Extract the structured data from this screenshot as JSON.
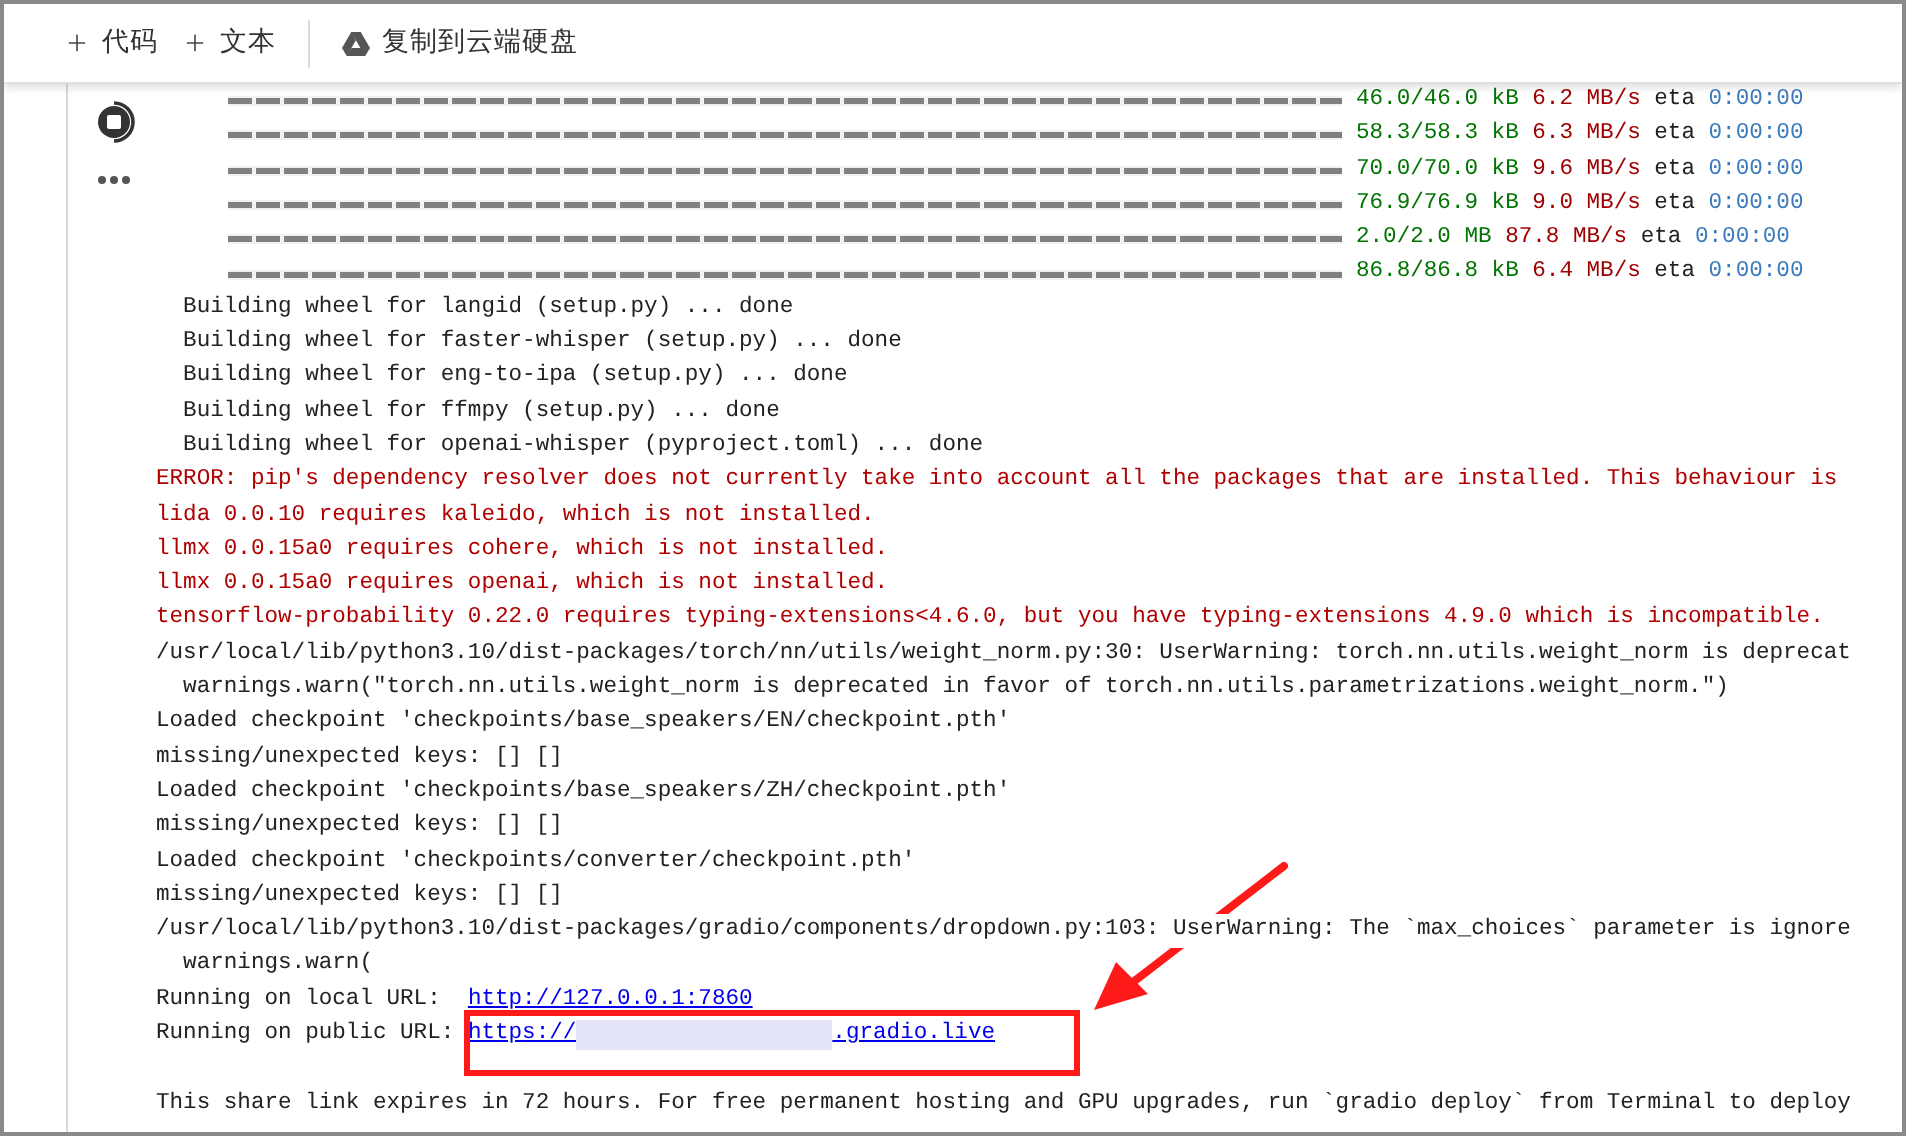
{
  "toolbar": {
    "buttons": [
      {
        "kind": "add",
        "label": "代码"
      },
      {
        "kind": "add",
        "label": "文本"
      },
      {
        "kind": "drive",
        "label": "复制到云端硬盘"
      }
    ]
  },
  "cell": {
    "running": true,
    "downloads": [
      {
        "level": 1,
        "size": "46.0/46.0 kB",
        "speed": "6.2 MB/s",
        "eta_label": "eta",
        "eta": "0:00:00"
      },
      {
        "level": 1,
        "size": "58.3/58.3 kB",
        "speed": "6.3 MB/s",
        "eta_label": "eta",
        "eta": "0:00:00"
      },
      {
        "level": 1,
        "size": "70.0/70.0 kB",
        "speed": "9.6 MB/s",
        "eta_label": "eta",
        "eta": "0:00:00"
      },
      {
        "level": 1,
        "size": "76.9/76.9 kB",
        "speed": "9.0 MB/s",
        "eta_label": "eta",
        "eta": "0:00:00"
      },
      {
        "level": 1,
        "size": "2.0/2.0 MB",
        "speed": "87.8 MB/s",
        "eta_label": "eta",
        "eta": "0:00:00"
      },
      {
        "level": 1,
        "size": "86.8/86.8 kB",
        "speed": "6.4 MB/s",
        "eta_label": "eta",
        "eta": "0:00:00"
      }
    ],
    "lines": [
      {
        "kind": "info",
        "text": "  Building wheel for langid (setup.py) ... done"
      },
      {
        "kind": "info",
        "text": "  Building wheel for faster-whisper (setup.py) ... done"
      },
      {
        "kind": "info",
        "text": "  Building wheel for eng-to-ipa (setup.py) ... done"
      },
      {
        "kind": "info",
        "text": "  Building wheel for ffmpy (setup.py) ... done"
      },
      {
        "kind": "info",
        "text": "  Building wheel for openai-whisper (pyproject.toml) ... done"
      },
      {
        "kind": "error",
        "text": "ERROR: pip's dependency resolver does not currently take into account all the packages that are installed. This behaviour is"
      },
      {
        "kind": "error",
        "text": "lida 0.0.10 requires kaleido, which is not installed."
      },
      {
        "kind": "error",
        "text": "llmx 0.0.15a0 requires cohere, which is not installed."
      },
      {
        "kind": "error",
        "text": "llmx 0.0.15a0 requires openai, which is not installed."
      },
      {
        "kind": "error",
        "text": "tensorflow-probability 0.22.0 requires typing-extensions<4.6.0, but you have typing-extensions 4.9.0 which is incompatible."
      },
      {
        "kind": "info",
        "text": "/usr/local/lib/python3.10/dist-packages/torch/nn/utils/weight_norm.py:30: UserWarning: torch.nn.utils.weight_norm is deprecat"
      },
      {
        "kind": "info",
        "text": "  warnings.warn(\"torch.nn.utils.weight_norm is deprecated in favor of torch.nn.utils.parametrizations.weight_norm.\")"
      },
      {
        "kind": "info",
        "text": "Loaded checkpoint 'checkpoints/base_speakers/EN/checkpoint.pth'"
      },
      {
        "kind": "info",
        "text": "missing/unexpected keys: [] []"
      },
      {
        "kind": "info",
        "text": "Loaded checkpoint 'checkpoints/base_speakers/ZH/checkpoint.pth'"
      },
      {
        "kind": "info",
        "text": "missing/unexpected keys: [] []"
      },
      {
        "kind": "info",
        "text": "Loaded checkpoint 'checkpoints/converter/checkpoint.pth'"
      },
      {
        "kind": "info",
        "text": "missing/unexpected keys: [] []"
      },
      {
        "kind": "info",
        "text": "/usr/local/lib/python3.10/dist-packages/gradio/components/dropdown.py:103: UserWarning: The `max_choices` parameter is ignore"
      },
      {
        "kind": "info",
        "text": "  warnings.warn("
      },
      {
        "kind": "link",
        "text": "Running on local URL:  ",
        "url": "http://127.0.0.1:7860"
      },
      {
        "kind": "redacted_link",
        "text": "Running on public URL: ",
        "url_start": "https://",
        "url_end": ".gradio.live",
        "highlighted": true
      },
      {
        "kind": "spacer"
      },
      {
        "kind": "info",
        "text": "This share link expires in 72 hours. For free permanent hosting and GPU upgrades, run `gradio deploy` from Terminal to deploy"
      }
    ]
  }
}
